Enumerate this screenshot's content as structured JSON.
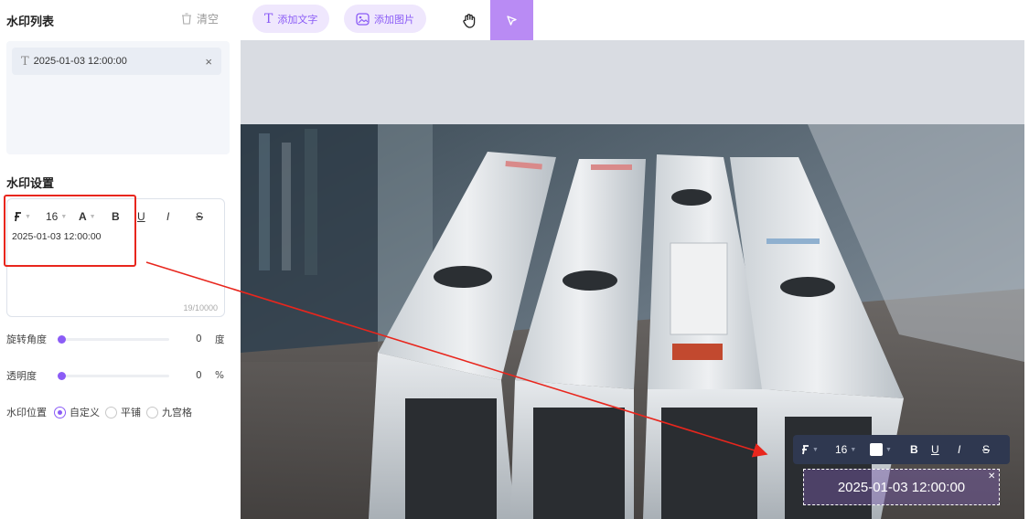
{
  "sidebar": {
    "list_title": "水印列表",
    "clear_label": "清空",
    "items": [
      {
        "type_icon": "text-type-icon",
        "label": "2025-01-03 12:00:00"
      }
    ],
    "settings_title": "水印设置",
    "editor": {
      "toolbar": {
        "font_icon": "font-family-icon",
        "font_size": "16",
        "color_label": "A",
        "bold": "B",
        "underline": "U",
        "italic": "I",
        "strike": "S"
      },
      "text": "2025-01-03 12:00:00",
      "counter": "19/10000"
    },
    "rotation": {
      "label": "旋转角度",
      "value": "0",
      "unit": "度",
      "level": 0
    },
    "opacity": {
      "label": "透明度",
      "value": "0",
      "unit": "%",
      "level": 0
    },
    "position": {
      "label": "水印位置",
      "options": [
        {
          "label": "自定义",
          "selected": true
        },
        {
          "label": "平铺",
          "selected": false
        },
        {
          "label": "九宫格",
          "selected": false
        }
      ]
    }
  },
  "toolbar": {
    "add_text": "添加文字",
    "add_image": "添加图片",
    "hand_tool": "hand-icon",
    "select_tool": "pointer-icon"
  },
  "canvas": {
    "float_toolbar": {
      "font_size": "16",
      "bold": "B",
      "underline": "U",
      "italic": "I",
      "strike": "S",
      "color": "#ffffff"
    },
    "watermark_text": "2025-01-03 12:00:00"
  },
  "colors": {
    "accent": "#8b5cf6",
    "annotation": "#e8261d",
    "float_toolbar_bg": "#2f3850"
  }
}
